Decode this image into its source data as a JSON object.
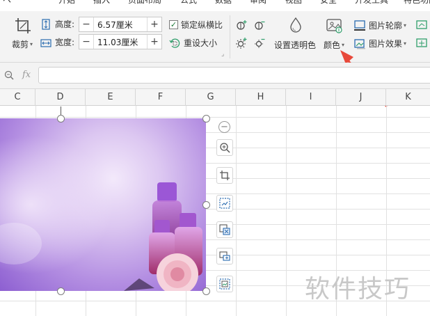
{
  "menu_tabs": [
    "开始",
    "插入",
    "页面布局",
    "公式",
    "数据",
    "审阅",
    "视图",
    "安全",
    "开发工具",
    "特色功能"
  ],
  "ribbon": {
    "crop_label": "裁剪",
    "height_label": "高度:",
    "height_value": "6.57厘米",
    "width_label": "宽度:",
    "width_value": "11.03厘米",
    "lock_ratio_label": "锁定纵横比",
    "lock_ratio_checked": true,
    "reset_size_label": "重设大小",
    "transparent_label": "设置透明色",
    "color_label": "颜色",
    "outline_label": "图片轮廓",
    "effect_label": "图片效果"
  },
  "formula_bar": {
    "fx_label": "fx",
    "value": ""
  },
  "columns": [
    "C",
    "D",
    "E",
    "F",
    "G",
    "H",
    "I",
    "J",
    "K"
  ],
  "watermark": "软件技巧",
  "colors": {
    "arrow": "#e8493b",
    "accent": "#2b6cb0"
  }
}
